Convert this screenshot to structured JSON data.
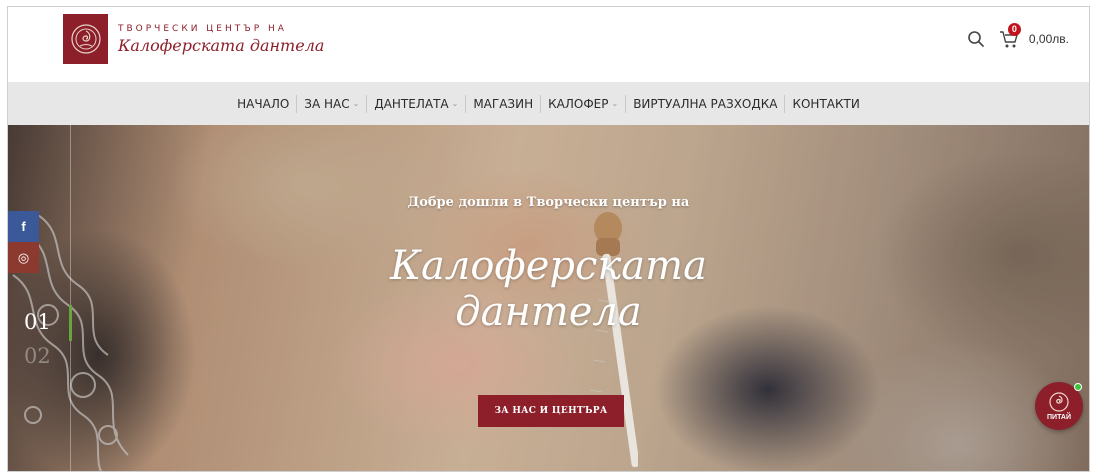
{
  "header": {
    "logo_line1": "ТВОРЧЕСКИ ЦЕНТЪР НА",
    "logo_line2": "Калоферската дантела",
    "cart_count": "0",
    "cart_total": "0,00лв."
  },
  "nav": {
    "items": [
      {
        "label": "НАЧАЛО"
      },
      {
        "label": "ЗА НАС"
      },
      {
        "label": "ДАНТЕЛАТА"
      },
      {
        "label": "МАГАЗИН"
      },
      {
        "label": "КАЛОФЕР"
      },
      {
        "label": "ВИРТУАЛНА РАЗХОДКА"
      },
      {
        "label": "КОНТАКТИ"
      }
    ]
  },
  "hero": {
    "subtitle": "Добре дошли в Творчески център на",
    "title_line1": "Калоферската",
    "title_line2": "дантела",
    "button_label": "ЗА НАС И ЦЕНТЪРА",
    "slide_current": "01",
    "slide_next": "02"
  },
  "social": {
    "facebook_glyph": "f",
    "instagram_glyph": "◎"
  },
  "chat": {
    "label": "ПИТАЙ"
  },
  "colors": {
    "brand": "#8c1f2a",
    "badge": "#c3131e",
    "facebook": "#3b5998",
    "nav_bg": "#e7e7e7",
    "slider_accent": "#6aa43c"
  },
  "icons": [
    "logo-emblem-icon",
    "search-icon",
    "cart-icon",
    "chevron-down-icon",
    "facebook-icon",
    "instagram-icon",
    "chat-logo-icon"
  ]
}
